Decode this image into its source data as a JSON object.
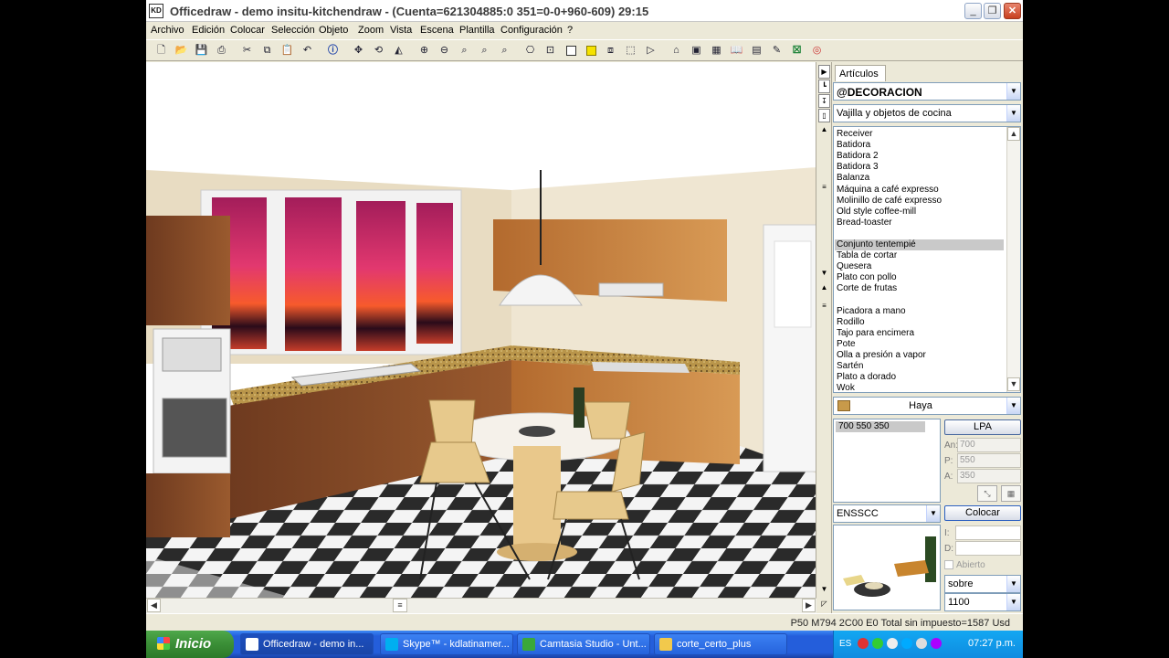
{
  "window": {
    "title": "Officedraw - demo insitu-kitchendraw - (Cuenta=621304885:0 351=0-0+960-609) 29:15",
    "app_icon_label": "KD",
    "min_label": "_",
    "max_label": "❐",
    "close_label": "✕"
  },
  "menu": [
    "Archivo",
    "Edición",
    "Colocar",
    "Selección",
    "Objeto",
    "Zoom",
    "Vista",
    "Escena",
    "Plantilla",
    "Configuración",
    "?"
  ],
  "toolbar_icons": [
    "new-icon",
    "open-icon",
    "save-icon",
    "print-icon",
    "cut-icon",
    "copy-icon",
    "paste-icon",
    "undo-icon",
    "info-icon",
    "move-icon",
    "rotate-icon",
    "measure-icon",
    "zoom-in-icon",
    "zoom-out-icon",
    "zoom-window-icon",
    "zoom-all-icon",
    "zoom-prev-icon",
    "camera-icon",
    "frame-icon",
    "square-icon",
    "yellow-square-icon",
    "box-icon",
    "cube-icon",
    "next-icon",
    "house-icon",
    "photo-icon",
    "grid-icon",
    "book-icon",
    "cabinet-icon",
    "edit-icon",
    "excel-icon",
    "color-icon"
  ],
  "panel": {
    "tab_label": "Artículos",
    "category": "@DECORACION",
    "subcategory": "Vajilla y objetos de cocina",
    "items": [
      {
        "label": "Receiver",
        "selected": false
      },
      {
        "label": "Batidora",
        "selected": false
      },
      {
        "label": "Batidora 2",
        "selected": false
      },
      {
        "label": "Batidora 3",
        "selected": false
      },
      {
        "label": "Balanza",
        "selected": false
      },
      {
        "label": "Máquina a café expresso",
        "selected": false
      },
      {
        "label": "Molinillo de café expresso",
        "selected": false
      },
      {
        "label": "Old style coffee-mill",
        "selected": false
      },
      {
        "label": "Bread-toaster",
        "selected": false
      },
      {
        "label": "",
        "selected": false
      },
      {
        "label": "Conjunto tentempié",
        "selected": true
      },
      {
        "label": "Tabla de cortar",
        "selected": false
      },
      {
        "label": "Quesera",
        "selected": false
      },
      {
        "label": "Plato con pollo",
        "selected": false
      },
      {
        "label": "Corte de frutas",
        "selected": false
      },
      {
        "label": "",
        "selected": false
      },
      {
        "label": "Picadora a mano",
        "selected": false
      },
      {
        "label": "Rodillo",
        "selected": false
      },
      {
        "label": "Tajo para encimera",
        "selected": false
      },
      {
        "label": "Pote",
        "selected": false
      },
      {
        "label": "Olla a presión a vapor",
        "selected": false
      },
      {
        "label": "Sartén",
        "selected": false
      },
      {
        "label": "Plato a dorado",
        "selected": false
      },
      {
        "label": "Wok",
        "selected": false
      }
    ],
    "material": "Haya",
    "material_color": "#c89a4a",
    "dims_selected": "700  550  350",
    "lpa_label": "LPA",
    "an_label": "An:",
    "an_value": "700",
    "p_label": "P:",
    "p_value": "550",
    "a_label": "A:",
    "a_value": "350",
    "code": "ENSSCC",
    "colocar_label": "Colocar",
    "i_label": "I:",
    "d_label": "D:",
    "abierto_label": "Abierto",
    "sobre": "sobre",
    "height": "1100"
  },
  "status": {
    "text": "P50 M794 2C00 E0 Total sin impuesto=1587 Usd"
  },
  "taskbar": {
    "start_label": "Inicio",
    "tasks": [
      {
        "label": "Officedraw - demo in...",
        "icon_color": "#ffffff",
        "active": true
      },
      {
        "label": "Skype™ - kdlatinamer...",
        "icon_color": "#00aff0",
        "active": false
      },
      {
        "label": "Camtasia Studio - Unt...",
        "icon_color": "#3aa83a",
        "active": false
      },
      {
        "label": "corte_certo_plus",
        "icon_color": "#f2c94c",
        "active": false
      }
    ],
    "lang": "ES",
    "clock": "07:27 p.m."
  }
}
